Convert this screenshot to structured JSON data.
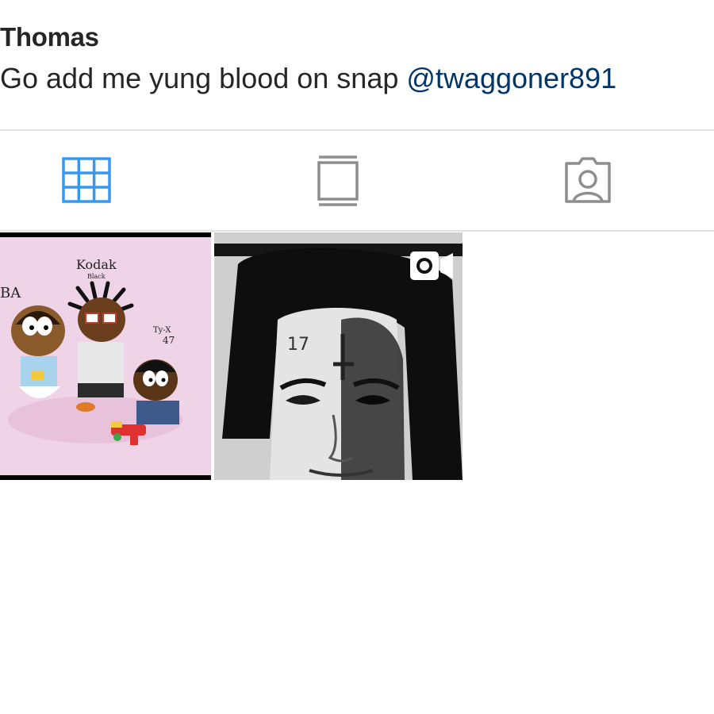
{
  "profile": {
    "name": "Thomas",
    "bio_text": "Go add me yung blood on snap",
    "bio_mention": "@twaggoner891"
  },
  "tabs": [
    {
      "icon": "grid-icon",
      "active": true
    },
    {
      "icon": "feed-icon",
      "active": false
    },
    {
      "icon": "tagged-icon",
      "active": false
    }
  ],
  "posts": [
    {
      "type": "image",
      "caption_texts": [
        "Kodak",
        "Black",
        "BA",
        "Ty-X",
        "47"
      ]
    },
    {
      "type": "video",
      "icon": "video-camera-icon"
    }
  ],
  "colors": {
    "accent": "#3897f0",
    "mention": "#003569",
    "text": "#262626",
    "inactive_icon": "#8e8e8e",
    "divider": "#e2e2e2"
  }
}
